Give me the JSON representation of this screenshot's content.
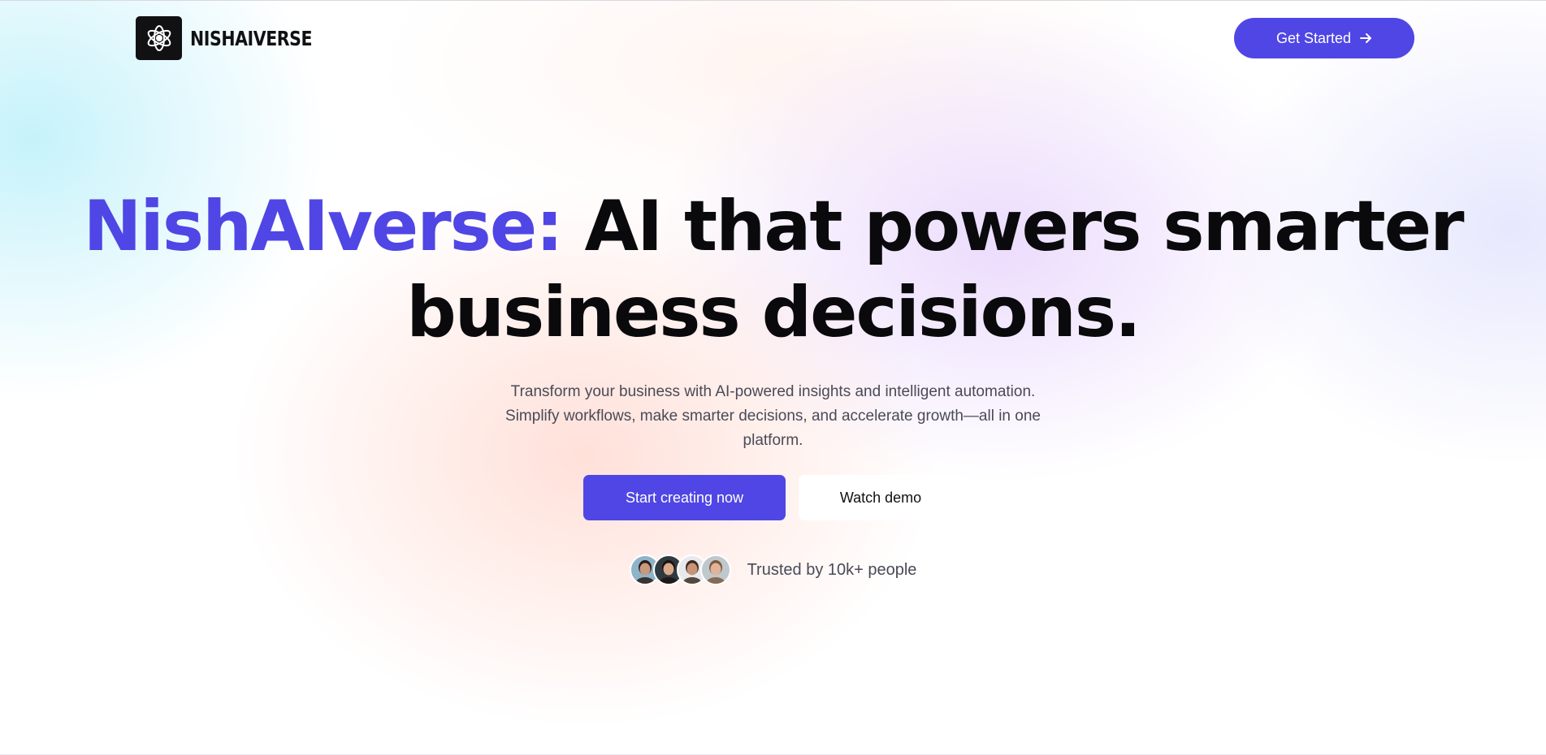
{
  "brand": {
    "name": "NISHAIVERSE",
    "logo_icon": "atom-knot-icon"
  },
  "header": {
    "cta_label": "Get Started",
    "cta_icon": "arrow-right-icon"
  },
  "hero": {
    "headline_accent": "NishAIverse:",
    "headline_line1_rest": "AI that powers smarter",
    "headline_line2": "business decisions.",
    "subtitle": "Transform your business with AI-powered insights and intelligent automation. Simplify workflows, make smarter decisions, and accelerate growth—all in one platform.",
    "primary_button": "Start creating now",
    "secondary_button": "Watch demo",
    "trust_text": "Trusted by 10k+ people"
  },
  "avatars": [
    {
      "name": "user-avatar-1",
      "bg": "#8fb3c9",
      "skin": "#c79a7c",
      "hair": "#2a1d17"
    },
    {
      "name": "user-avatar-2",
      "bg": "#2f3a40",
      "skin": "#d9a98a",
      "hair": "#1c1410"
    },
    {
      "name": "user-avatar-3",
      "bg": "#e7e9ec",
      "skin": "#c89478",
      "hair": "#3b2a20"
    },
    {
      "name": "user-avatar-4",
      "bg": "#bfc8cc",
      "skin": "#e0b39a",
      "hair": "#7a5a3e"
    }
  ],
  "colors": {
    "accent": "#4f46e5",
    "text_dark": "#0a0a0c",
    "text_muted": "#4a4a57"
  }
}
